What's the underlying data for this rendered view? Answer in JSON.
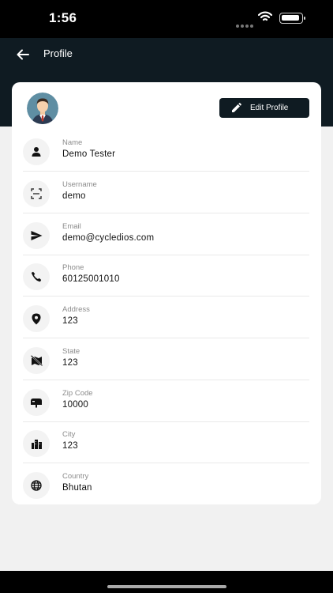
{
  "status_bar": {
    "time": "1:56"
  },
  "header": {
    "title": "Profile"
  },
  "profile": {
    "edit_label": "Edit Profile"
  },
  "fields": [
    {
      "label": "Name",
      "value": "Demo Tester",
      "icon": "person-icon"
    },
    {
      "label": "Username",
      "value": "demo",
      "icon": "scan-icon"
    },
    {
      "label": "Email",
      "value": "demo@cycledios.com",
      "icon": "send-icon"
    },
    {
      "label": "Phone",
      "value": "60125001010",
      "icon": "phone-icon"
    },
    {
      "label": "Address",
      "value": "123",
      "icon": "location-pin-icon"
    },
    {
      "label": "State",
      "value": "123",
      "icon": "map-off-icon"
    },
    {
      "label": "Zip Code",
      "value": "10000",
      "icon": "mailbox-icon"
    },
    {
      "label": "City",
      "value": "123",
      "icon": "city-icon"
    },
    {
      "label": "Country",
      "value": "Bhutan",
      "icon": "globe-icon"
    }
  ],
  "colors": {
    "header_bg": "#0f1b22",
    "card_bg": "#ffffff",
    "page_bg": "#f1f1f1"
  }
}
